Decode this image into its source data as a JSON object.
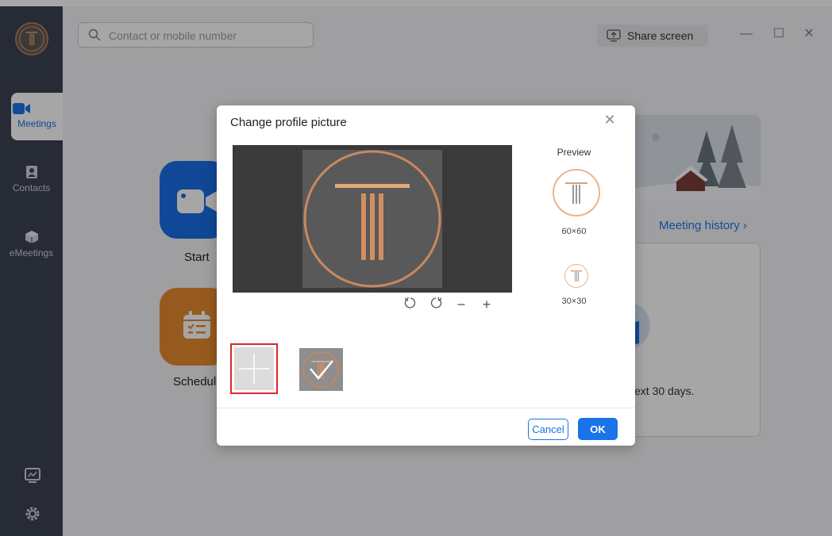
{
  "sidebar": {
    "items": [
      {
        "label": "Meetings",
        "icon": "video-camera-icon"
      },
      {
        "label": "Contacts",
        "icon": "contacts-icon"
      },
      {
        "label": "eMeetings",
        "icon": "cube-icon"
      }
    ],
    "bottom_icons": [
      "screen-monitor-icon",
      "gear-icon"
    ]
  },
  "header": {
    "search_placeholder": "Contact or mobile number",
    "share_label": "Share screen"
  },
  "main": {
    "tiles": [
      {
        "label": "Start",
        "color": "#1a6fe8",
        "icon": "video-camera-icon"
      },
      {
        "label": "Schedul",
        "color": "#e98a2f",
        "icon": "calendar-icon"
      }
    ],
    "history_link": "Meeting history",
    "card_text": "ext 30 days."
  },
  "dialog": {
    "title": "Change profile picture",
    "preview_label": "Preview",
    "size_large": "60×60",
    "size_small": "30×30",
    "cancel_label": "Cancel",
    "ok_label": "OK",
    "tools": [
      "rotate-left-icon",
      "rotate-right-icon",
      "zoom-out-icon",
      "zoom-in-icon"
    ]
  },
  "colors": {
    "accent": "#1a73e8",
    "sidebar": "#3b4253",
    "logo_gold": "#d49a6a",
    "selection_red": "#e0252b"
  }
}
